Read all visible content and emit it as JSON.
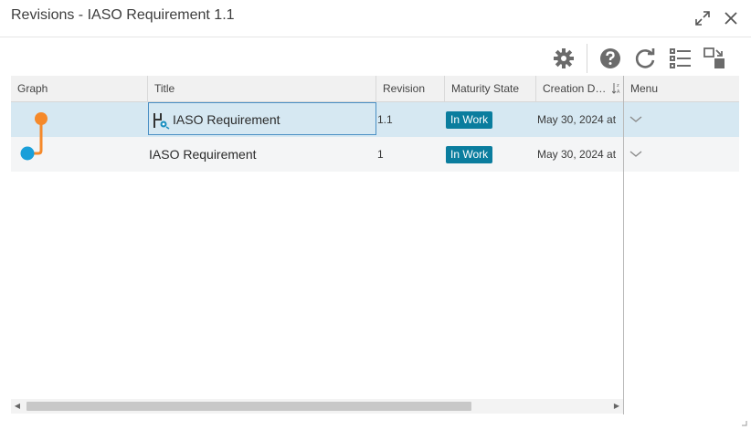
{
  "window": {
    "title": "Revisions - IASO Requirement 1.1"
  },
  "toolbar": {
    "icons": [
      "settings-icon",
      "help-icon",
      "refresh-icon",
      "list-view-icon",
      "switch-view-icon"
    ]
  },
  "grid": {
    "columns": [
      "Graph",
      "Title",
      "Revision",
      "Maturity State",
      "Creation D…",
      "Menu"
    ],
    "rows": [
      {
        "title": "IASO Requirement",
        "revision": "1.1",
        "maturity": "In Work",
        "created": "May 30, 2024 at",
        "selected": true
      },
      {
        "title": "IASO Requirement",
        "revision": "1",
        "maturity": "In Work",
        "created": "May 30, 2024 at",
        "selected": false
      }
    ]
  },
  "colors": {
    "accent": "#0a7d9e",
    "graph_orange": "#f5892a",
    "graph_blue": "#1a9fd9",
    "selected_row": "#d6e8f2"
  }
}
